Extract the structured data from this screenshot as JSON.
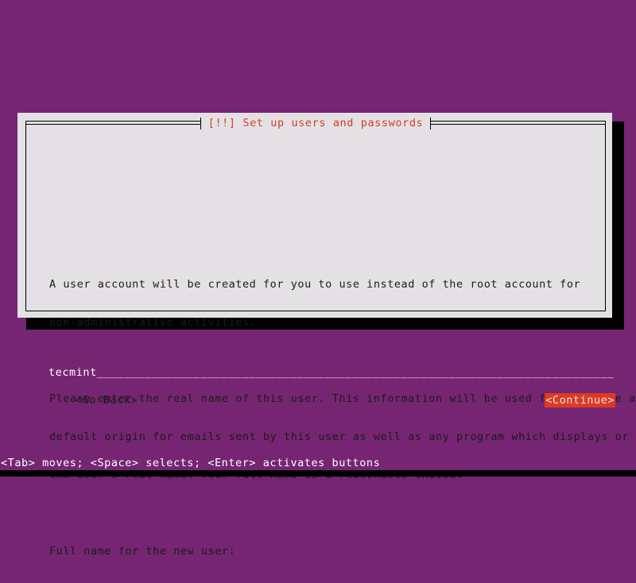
{
  "screen": {
    "background_color": "#762572",
    "panel_color": "#e4e1e4",
    "accent_red": "#dd3a24",
    "title_red": "#d83c26",
    "shadow_color": "#000000"
  },
  "dialog": {
    "title": "[!!] Set up users and passwords",
    "paragraphs": [
      [
        "A user account will be created for you to use instead of the root account for",
        "non-administrative activities."
      ],
      [
        "Please enter the real name of this user. This information will be used for instance as",
        "default origin for emails sent by this user as well as any program which displays or uses",
        "the user's real name. Your full name is a reasonable choice."
      ],
      [
        "Full name for the new user:"
      ]
    ],
    "input": {
      "value": "tecmint",
      "fill_char": "_",
      "fill_count": 80
    },
    "buttons": {
      "go_back": "<Go Back>",
      "continue": "<Continue>"
    }
  },
  "hint_bar": {
    "text": "<Tab> moves; <Space> selects; <Enter> activates buttons"
  }
}
